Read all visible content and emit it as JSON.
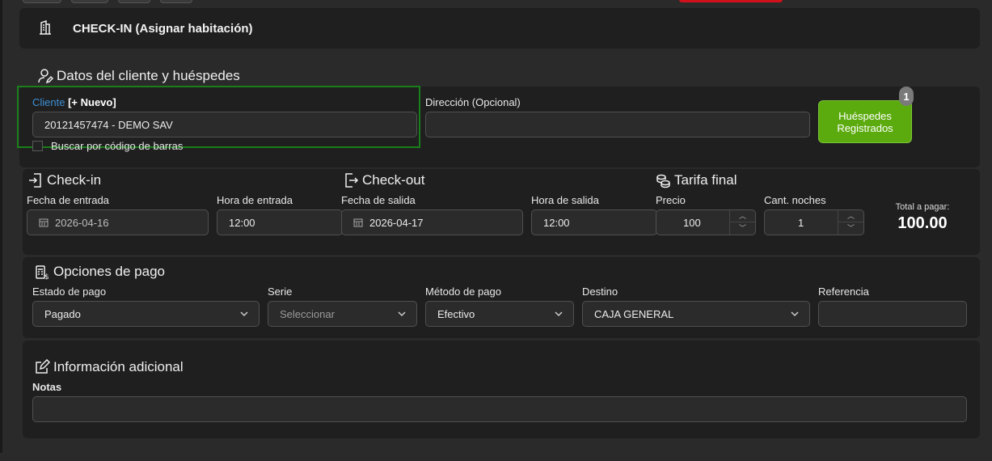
{
  "header": {
    "title": "CHECK-IN (Asignar habitación)",
    "icon": "building-icon"
  },
  "client_section": {
    "title": "Datos del cliente y huéspedes",
    "client_label": "Cliente",
    "new_link": "[+ Nuevo]",
    "client_value": "20121457474 - DEMO SAV",
    "address_label": "Dirección (Opcional)",
    "address_value": "",
    "barcode_label": "Buscar por código de barras",
    "guests_button": "Huéspedes Registrados",
    "guests_count": "1"
  },
  "checkin": {
    "title": "Check-in",
    "date_label": "Fecha de entrada",
    "date_value": "2026-04-16",
    "time_label": "Hora de entrada",
    "time_value": "12:00"
  },
  "checkout": {
    "title": "Check-out",
    "date_label": "Fecha de salida",
    "date_value": "2026-04-17",
    "time_label": "Hora de salida",
    "time_value": "12:00"
  },
  "rate": {
    "title": "Tarifa final",
    "price_label": "Precio",
    "price_value": "100",
    "nights_label": "Cant. noches",
    "nights_value": "1",
    "total_label": "Total a pagar:",
    "total_value": "100.00"
  },
  "payment": {
    "title": "Opciones de pago",
    "status_label": "Estado de pago",
    "status_value": "Pagado",
    "series_label": "Serie",
    "series_placeholder": "Seleccionar",
    "method_label": "Método de pago",
    "method_value": "Efectivo",
    "destination_label": "Destino",
    "destination_value": "CAJA GENERAL",
    "reference_label": "Referencia",
    "reference_value": ""
  },
  "additional": {
    "title": "Información adicional",
    "notes_label": "Notas",
    "notes_value": ""
  },
  "colors": {
    "accent_green": "#5cab0e",
    "link_blue": "#3d8fd6",
    "highlight_green": "#1a7f1a"
  }
}
